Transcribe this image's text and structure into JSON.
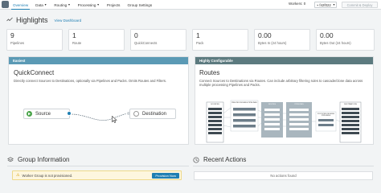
{
  "nav": {
    "items": [
      {
        "label": "Overview",
        "caret": false
      },
      {
        "label": "Data",
        "caret": true
      },
      {
        "label": "Routing",
        "caret": true
      },
      {
        "label": "Processing",
        "caret": true
      },
      {
        "label": "Projects",
        "caret": false
      },
      {
        "label": "Group Settings",
        "caret": false
      }
    ],
    "workers": "Workers: 0",
    "version": "f42f022",
    "commit": "Commit & Deploy"
  },
  "highlights": {
    "title": "Highlights",
    "link": "View Dashboard",
    "cards": [
      {
        "value": "9",
        "label": "Pipelines"
      },
      {
        "value": "1",
        "label": "Route"
      },
      {
        "value": "0",
        "label": "QuickConnects"
      },
      {
        "value": "1",
        "label": "Pack"
      },
      {
        "value": "0.00",
        "label": "Bytes In (24 hours)"
      },
      {
        "value": "0.00",
        "label": "Bytes Out (24 hours)"
      }
    ]
  },
  "quickconnect": {
    "header": "Easiest",
    "title": "QuickConnect",
    "desc": "Directly connect Sources to Destinations, optionally via Pipelines and Packs. Omits Routes and Filters.",
    "source": "Source",
    "destination": "Destination"
  },
  "routes": {
    "header": "Highly Configurable",
    "title": "Routes",
    "desc": "Connect Sources to Destinations via Routes. Can include arbitrary filtering rules to cascade/clone data across multiple processing Pipelines and Packs.",
    "diagram": {
      "sources": "SOURCES",
      "pre": "PRE-PROCESSING PIPELINES",
      "routes": "ROUTES",
      "pipelines": "PIPELINES",
      "post": "POST-PROCESSING PIPELINES",
      "destinations": "DESTINATIONS"
    }
  },
  "group": {
    "title": "Group Information",
    "warning": "Worker Group is not provisioned.",
    "button": "Provision Now"
  },
  "recent": {
    "title": "Recent Actions",
    "empty": "No actions found"
  },
  "colors": {
    "accent": "#1f7fb3",
    "easiest": "#5b9ab5",
    "configurable": "#5c7a7f",
    "source_green": "#4aa44a"
  }
}
